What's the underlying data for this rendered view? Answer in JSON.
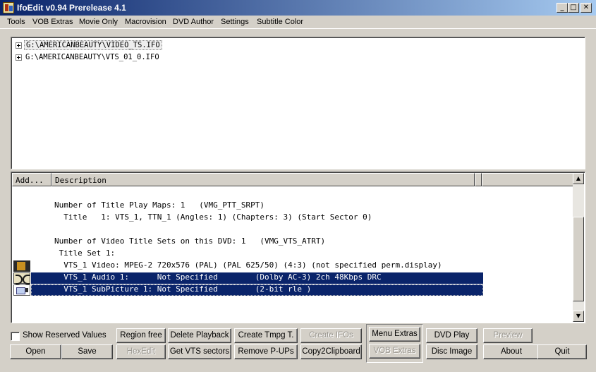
{
  "window": {
    "title": "IfoEdit v0.94 Prerelease 4.1",
    "minimize_glyph": "_",
    "maximize_glyph": "□",
    "close_glyph": "✕"
  },
  "menu": [
    "Tools",
    "VOB Extras",
    "Movie Only",
    "Macrovision",
    "DVD Author",
    "Settings",
    "Subtitle Color"
  ],
  "tree": {
    "items": [
      {
        "label": "G:\\AMERICANBEAUTY\\VIDEO_TS.IFO",
        "selected": true
      },
      {
        "label": "G:\\AMERICANBEAUTY\\VTS_01_0.IFO",
        "selected": false
      }
    ]
  },
  "list": {
    "headers": {
      "add": "Add...",
      "description": "Description"
    },
    "lines": [
      "Number of Title Play Maps: 1   (VMG_PTT_SRPT)",
      "  Title   1: VTS_1, TTN_1 (Angles: 1) (Chapters: 3) (Start Sector 0)",
      "Number of Video Title Sets on this DVD: 1   (VMG_VTS_ATRT)",
      " Title Set 1:",
      "  VTS_1 Video: MPEG-2 720x576 (PAL) (PAL 625/50) (4:3) (not specified perm.display)",
      "  VTS_1 Audio 1:      Not Specified        (Dolby AC-3) 2ch 48Kbps DRC",
      "  VTS_1 SubPicture 1: Not Specified        (2-bit rle )"
    ],
    "icons": [
      "film-icon",
      "dolby-icon",
      "subpicture-icon"
    ],
    "scroll_up_glyph": "▲",
    "scroll_down_glyph": "▼"
  },
  "controls": {
    "show_reserved_label": "Show Reserved Values",
    "show_reserved_checked": false,
    "buttons": {
      "open": "Open",
      "save": "Save",
      "region_free": "Region free",
      "hexedit": "HexEdit",
      "delete_playback": "Delete Playback",
      "get_vts_sectors": "Get VTS sectors",
      "create_tmpg": "Create Tmpg T.",
      "remove_pups": "Remove P-UPs",
      "create_ifos": "Create IFOs",
      "copy2clipboard": "Copy2Clipboard",
      "menu_extras": "Menu Extras",
      "vob_extras": "VOB Extras",
      "dvd_play": "DVD Play",
      "disc_image": "Disc Image",
      "preview": "Preview",
      "about": "About",
      "quit": "Quit"
    }
  },
  "colors": {
    "titlebar": "#0a246a",
    "selection": "#0a246a",
    "face": "#d4d0c8"
  }
}
